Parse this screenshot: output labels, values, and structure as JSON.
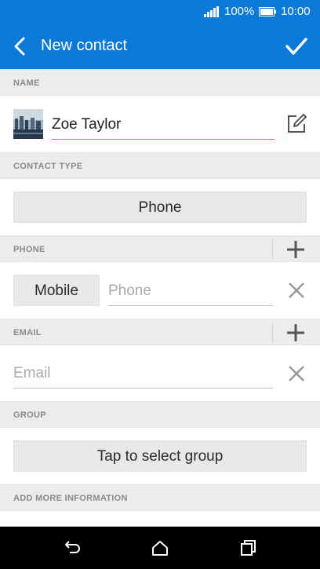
{
  "status_bar": {
    "battery_percent": "100%",
    "time": "10:00"
  },
  "app_bar": {
    "title": "New contact"
  },
  "sections": {
    "name": "NAME",
    "contact_type": "CONTACT TYPE",
    "phone": "PHONE",
    "email": "EMAIL",
    "group": "GROUP",
    "add_more": "ADD MORE INFORMATION"
  },
  "contact": {
    "name_value": "Zoe Taylor",
    "type_label": "Phone",
    "phone_type_label": "Mobile",
    "phone_placeholder": "Phone",
    "email_placeholder": "Email",
    "group_label": "Tap to select group"
  },
  "icons": {
    "back": "back-arrow-icon",
    "done": "checkmark-icon",
    "edit": "edit-icon",
    "add": "plus-icon",
    "remove": "close-icon",
    "nav_back": "back-icon",
    "nav_home": "home-icon",
    "nav_recents": "recents-icon"
  },
  "colors": {
    "accent": "#0a79d8",
    "input_focus": "#3ab2e6",
    "section_bg": "#ececec",
    "button_bg": "#e8e8e8"
  }
}
